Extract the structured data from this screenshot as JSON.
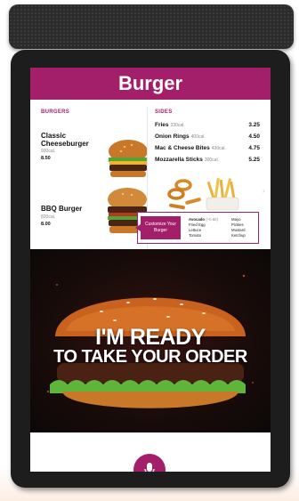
{
  "header": {
    "title": "Burger"
  },
  "burgers": {
    "section_title": "BURGERS",
    "items": [
      {
        "name": "Classic Cheeseburger",
        "calories": "930cal.",
        "price": "8.50"
      },
      {
        "name": "BBQ Burger",
        "calories": "820cal.",
        "price": "8.00"
      }
    ]
  },
  "sides": {
    "section_title": "SIDES",
    "items": [
      {
        "name": "Fries",
        "calories": "330cal.",
        "price": "3.25"
      },
      {
        "name": "Onion Rings",
        "calories": "400cal.",
        "price": "4.50"
      },
      {
        "name": "Mac & Cheese Bites",
        "calories": "430cal.",
        "price": "4.75"
      },
      {
        "name": "Mozzarella Sticks",
        "calories": "300cal.",
        "price": "5.25"
      }
    ]
  },
  "customize": {
    "label": "Customize Your Burger",
    "options_left": [
      "Avocado",
      "Fried Egg",
      "Lettuce",
      "Tomato"
    ],
    "options_left_extra": "(+0.60)",
    "options_right": [
      "Mayo",
      "Pickles",
      "Mustard",
      "Ketchup"
    ]
  },
  "hero": {
    "line1": "I'M READY",
    "line2": "TO TAKE YOUR ORDER"
  },
  "colors": {
    "brand": "#a31f6a",
    "bezel": "#1d1d1d"
  },
  "icons": {
    "mic": "microphone-icon",
    "scroll": "chevron-right-icon"
  }
}
